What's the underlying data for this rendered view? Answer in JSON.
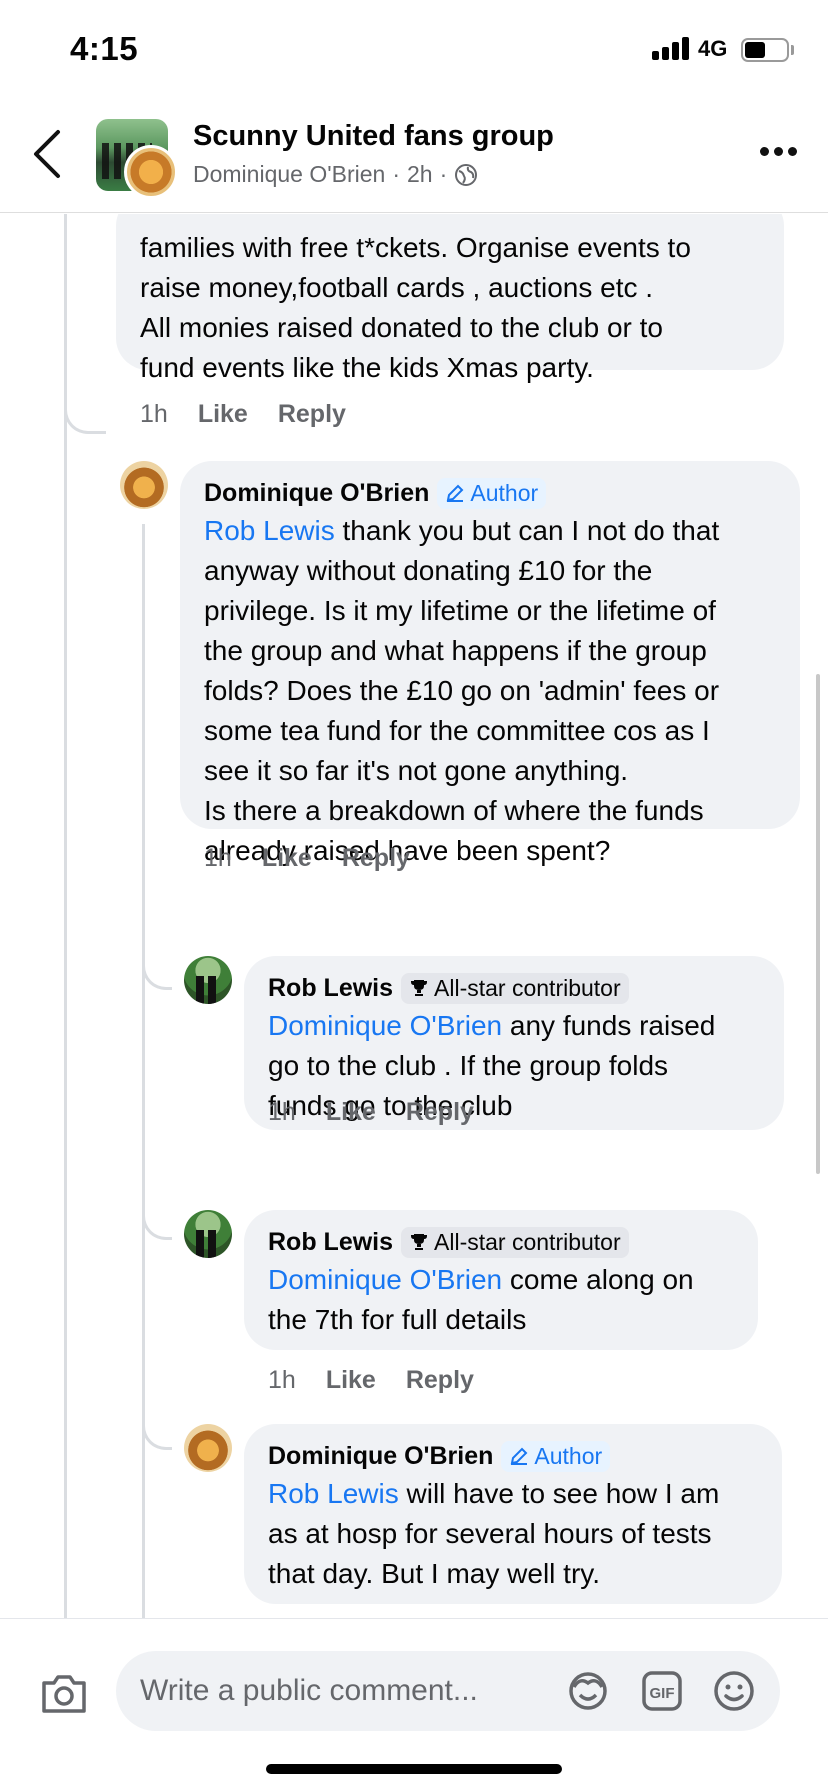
{
  "status_bar": {
    "time": "4:15",
    "network": "4G"
  },
  "header": {
    "group_name": "Scunny United fans group",
    "poster": "Dominique O'Brien",
    "age": "2h"
  },
  "top_comment": {
    "text": "families with free  t*ckets. Organise events to\nraise money,football cards , auctions etc .\nAll monies raised donated to the club or to\nfund events like the kids Xmas party.",
    "time": "1h",
    "like": "Like",
    "reply": "Reply"
  },
  "comments": [
    {
      "author": "Dominique O'Brien",
      "badge": "Author",
      "mention": "Rob Lewis",
      "body": " thank you but can I not do that\nanyway without donating £10 for the\nprivilege. Is it my lifetime or the lifetime of\nthe group and what happens if the group\nfolds? Does the £10 go on 'admin' fees or\nsome tea fund for the committee cos as I\nsee it so far it's not gone anything.\nIs there a breakdown of where the funds\nalready raised have been spent?",
      "time": "1h",
      "like": "Like",
      "reply": "Reply"
    },
    {
      "author": "Rob Lewis",
      "badge": "All-star contributor",
      "mention": "Dominique O'Brien",
      "body": " any funds raised\ngo to the club . If the group folds\nfunds go to the club",
      "time": "1h",
      "like": "Like",
      "reply": "Reply"
    },
    {
      "author": "Rob Lewis",
      "badge": "All-star contributor",
      "mention": "Dominique O'Brien",
      "body": " come along on\nthe 7th for full details",
      "time": "1h",
      "like": "Like",
      "reply": "Reply"
    },
    {
      "author": "Dominique O'Brien",
      "badge": "Author",
      "mention": "Rob Lewis",
      "body": " will have to see how I am\nas at hosp for several hours of tests\nthat day. But I may well try."
    }
  ],
  "composer": {
    "placeholder": "Write a public comment..."
  },
  "icons": [
    "camera-icon",
    "avatar-sticker-icon",
    "gif-icon",
    "emoji-icon",
    "globe-icon",
    "pencil-icon",
    "trophy-icon"
  ]
}
